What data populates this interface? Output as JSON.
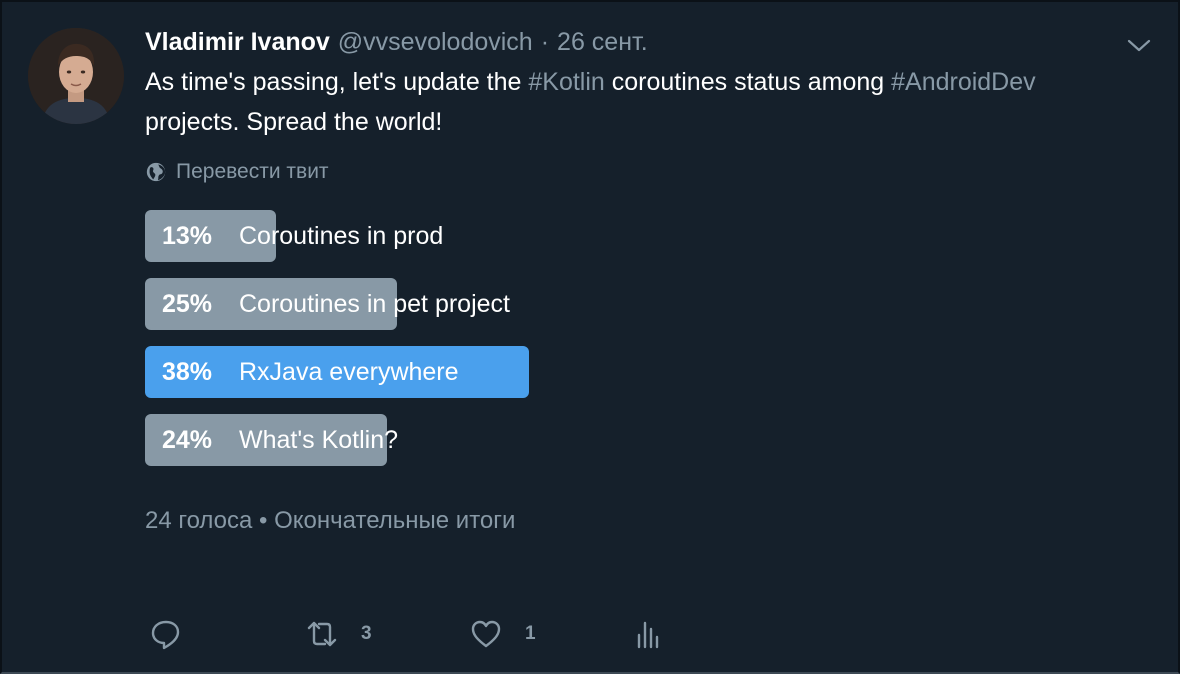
{
  "tweet": {
    "author_name": "Vladimir Ivanov",
    "author_handle": "@vvsevolodovich",
    "separator": "·",
    "date": "26 сент.",
    "text": {
      "part1": "As time's passing, let's update the ",
      "hashtag1": "#Kotlin",
      "part2": " coroutines status among ",
      "hashtag2": "#AndroidDev",
      "part3": " projects. Spread the world!"
    },
    "translate_label": "Перевести твит"
  },
  "poll": {
    "options": [
      {
        "percent": "13%",
        "label": "Coroutines in prod",
        "value": 13,
        "winner": false
      },
      {
        "percent": "25%",
        "label": "Coroutines in pet project",
        "value": 25,
        "winner": false
      },
      {
        "percent": "38%",
        "label": "RxJava everywhere",
        "value": 38,
        "winner": true
      },
      {
        "percent": "24%",
        "label": "What's Kotlin?",
        "value": 24,
        "winner": false
      }
    ],
    "meta": "24 голоса • Окончательные итоги"
  },
  "actions": {
    "reply_count": "",
    "retweet_count": "3",
    "like_count": "1"
  },
  "colors": {
    "background": "#15202b",
    "secondary_text": "#8899a6",
    "poll_bar": "#8899a6",
    "poll_winner": "#4aa0ed"
  },
  "icons": [
    "avatar",
    "chevron-down-icon",
    "globe-icon",
    "reply-icon",
    "retweet-icon",
    "like-icon",
    "analytics-icon"
  ]
}
